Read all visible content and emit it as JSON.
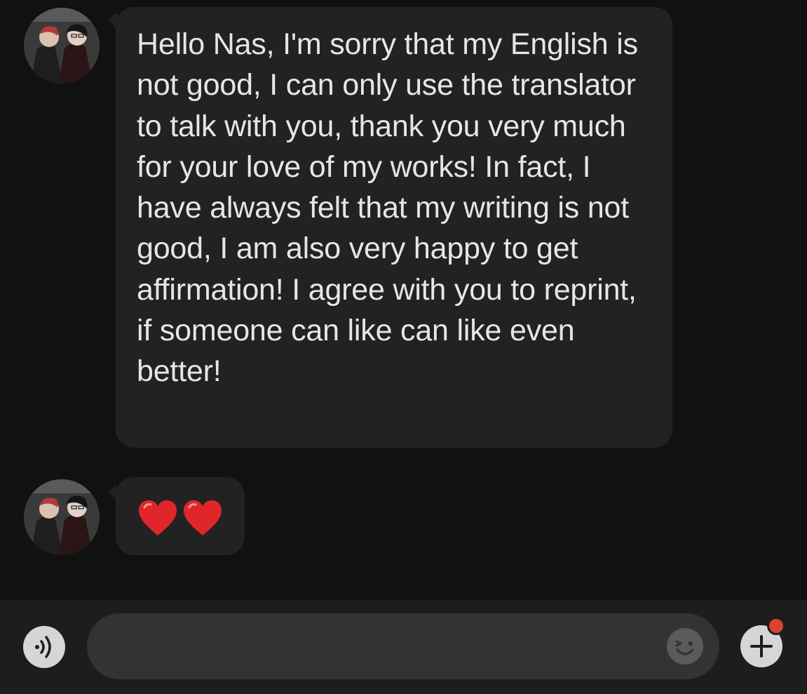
{
  "conversation": {
    "messages": [
      {
        "sender": "avatar-user",
        "text": "Hello Nas, I'm sorry that my English is not good, I can only use the translator to talk with you, thank you very much for your love of my works! In fact, I have always felt that my writing is not good, I am also very happy to get affirmation! I agree with you to reprint, if someone can like can like even better!"
      },
      {
        "sender": "avatar-user",
        "emoji": [
          "red-heart",
          "red-heart"
        ]
      }
    ]
  },
  "composer": {
    "placeholder": "",
    "value": "",
    "icons": {
      "voice": "voice-icon",
      "emoji": "emoji-icon",
      "add": "plus-icon"
    },
    "notification_color": "#d9432f"
  },
  "colors": {
    "background": "#111111",
    "bubble": "#222222",
    "text": "#e6e6e6",
    "input_bar": "#1d1d1d",
    "input_field": "#333333",
    "heart": "#e0262b"
  }
}
